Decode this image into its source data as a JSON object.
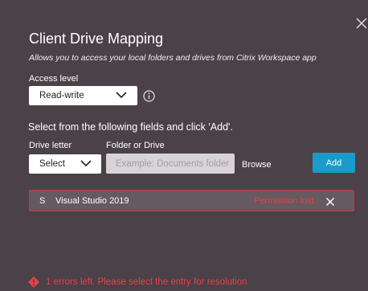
{
  "dialog": {
    "title": "Client Drive Mapping",
    "subtitle": "Allows you to access your local folders and drives from Citrix Workspace app"
  },
  "access": {
    "label": "Access level",
    "selected": "Read-write"
  },
  "instructions": "Select from the following fields and click 'Add'.",
  "drive": {
    "label": "Drive letter",
    "selected": "Select"
  },
  "folder": {
    "label": "Folder or Drive",
    "placeholder": "Example: Documents folder"
  },
  "buttons": {
    "browse": "Browse",
    "add": "Add"
  },
  "entries": [
    {
      "letter": "S",
      "name": "Visual Studio 2019",
      "status": "Permission lost"
    }
  ],
  "error": {
    "message": "1 errors left. Please select the entry for resolution"
  },
  "icons": {
    "close": "close-icon",
    "info": "info-icon",
    "chevron": "chevron-down-icon",
    "remove": "remove-icon",
    "warning": "error-diamond-icon"
  },
  "colors": {
    "background": "#4b4149",
    "accent": "#1a9bc9",
    "error": "#e8404a",
    "entry_border": "#d6333a"
  }
}
